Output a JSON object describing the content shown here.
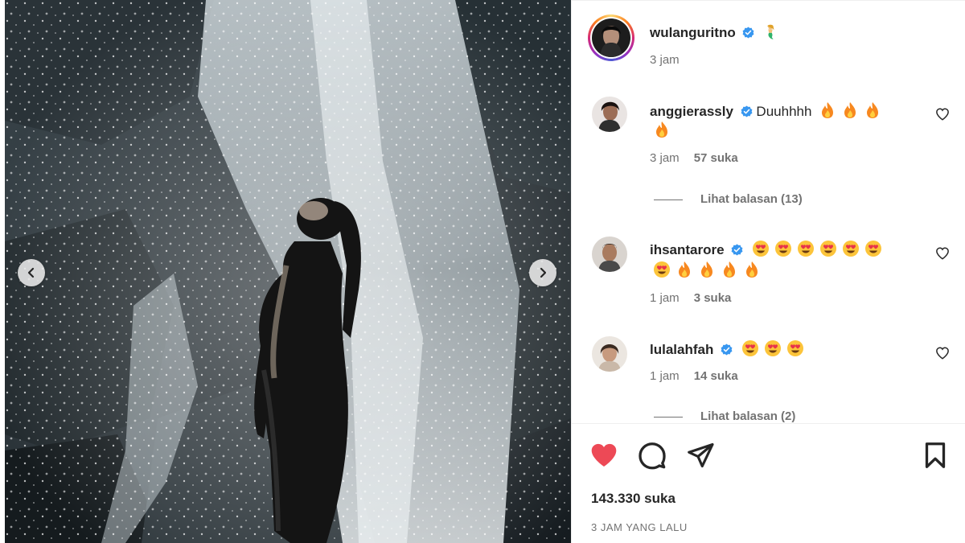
{
  "post": {
    "owner": {
      "username": "wulanguritno",
      "time": "3 jam",
      "badge_icon": "mermaid-emoji-icon"
    },
    "likes_total": "143.330 suka",
    "timestamp": "3 JAM YANG LALU",
    "liked": true,
    "colors": {
      "like": "#ed4956",
      "verified": "#3897f0",
      "muted": "#737373",
      "text": "#262626"
    }
  },
  "comments": [
    {
      "username": "anggierassly",
      "text": "Duuhhhh",
      "time": "3 jam",
      "likes": "57 suka",
      "emoji_line1": [
        "fire",
        "fire",
        "fire"
      ],
      "emoji_line2": [
        "fire"
      ],
      "replies": "Lihat balasan (13)"
    },
    {
      "username": "ihsantarore",
      "text": "",
      "time": "1 jam",
      "likes": "3 suka",
      "emoji_line1": [
        "heart-eyes",
        "heart-eyes",
        "heart-eyes",
        "heart-eyes",
        "heart-eyes",
        "heart-eyes"
      ],
      "emoji_line2": [
        "heart-eyes",
        "fire",
        "fire",
        "fire",
        "fire"
      ]
    },
    {
      "username": "lulalahfah",
      "text": "",
      "time": "1 jam",
      "likes": "14 suka",
      "emoji_line1": [
        "heart-eyes",
        "heart-eyes",
        "heart-eyes"
      ],
      "replies": "Lihat balasan (2)"
    }
  ],
  "actions": [
    "heart-icon",
    "comment-icon",
    "share-icon",
    "bookmark-icon"
  ],
  "carousel": {
    "prev": "chevron-left-icon",
    "next": "chevron-right-icon"
  }
}
